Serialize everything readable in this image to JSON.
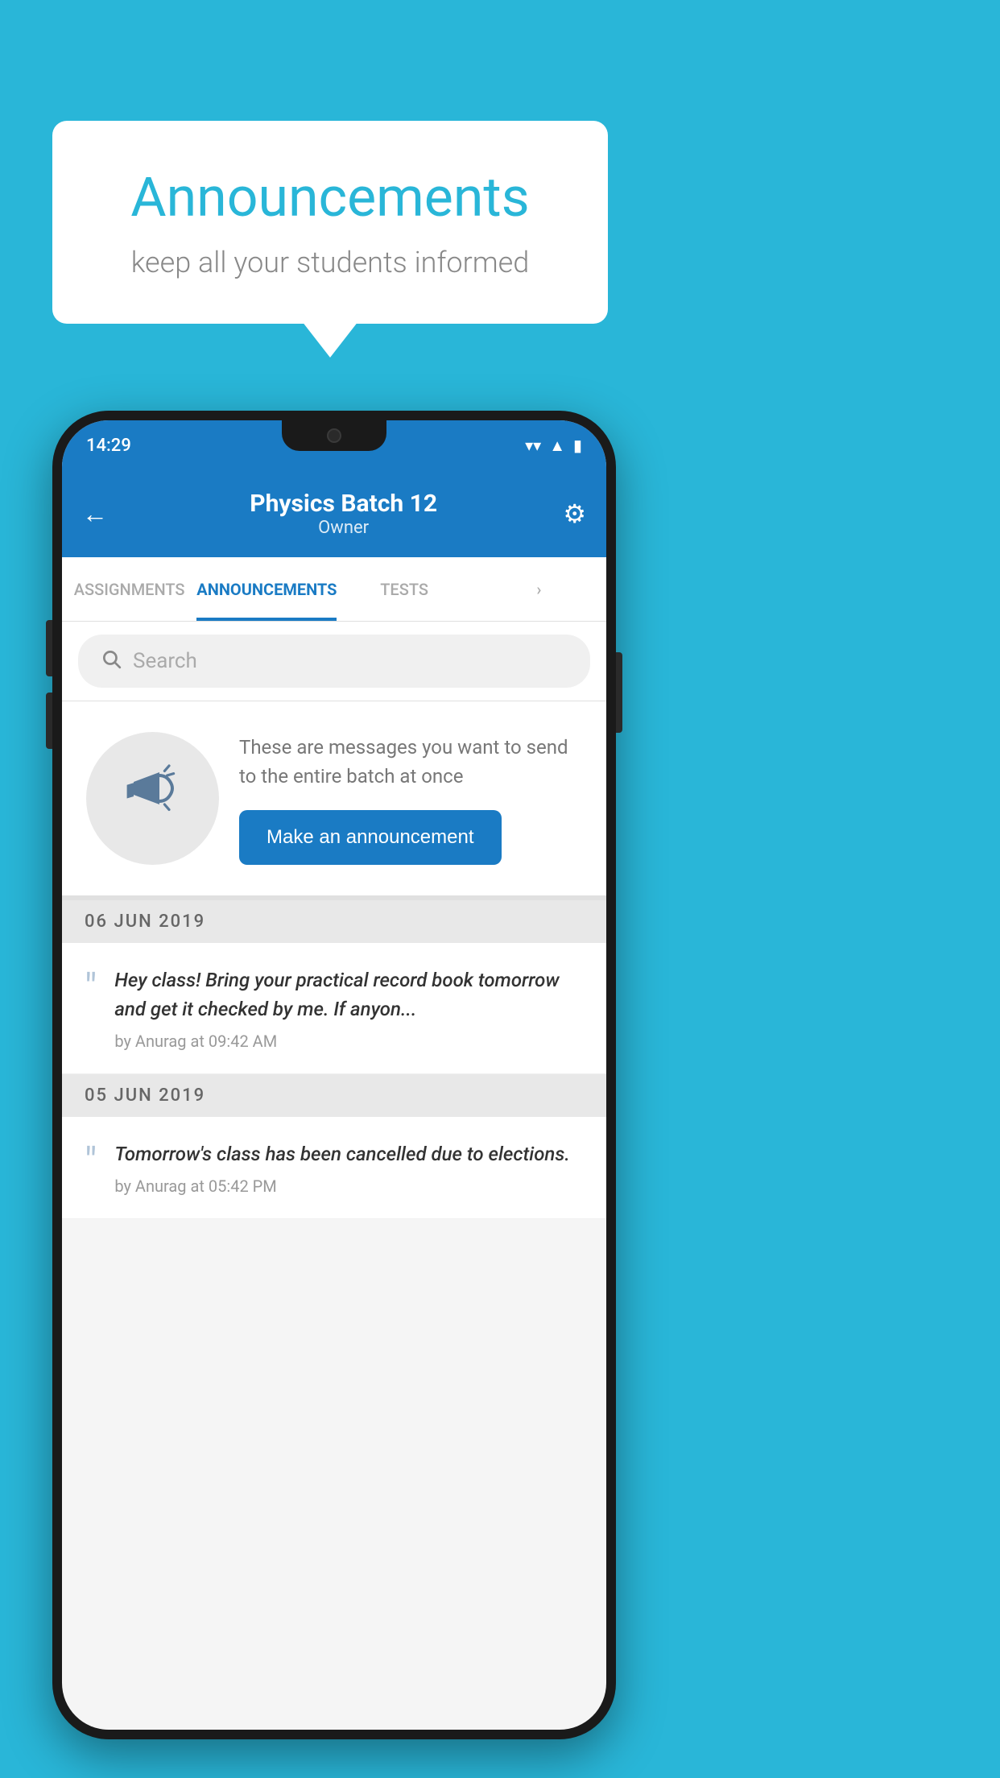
{
  "background_color": "#29b6d8",
  "speech_bubble": {
    "title": "Announcements",
    "subtitle": "keep all your students informed"
  },
  "phone": {
    "status_bar": {
      "time": "14:29",
      "icons": [
        "wifi",
        "signal",
        "battery"
      ]
    },
    "app_bar": {
      "title": "Physics Batch 12",
      "subtitle": "Owner",
      "back_label": "←",
      "settings_label": "⚙"
    },
    "tabs": [
      {
        "label": "ASSIGNMENTS",
        "active": false
      },
      {
        "label": "ANNOUNCEMENTS",
        "active": true
      },
      {
        "label": "TESTS",
        "active": false
      },
      {
        "label": "...",
        "active": false
      }
    ],
    "search": {
      "placeholder": "Search"
    },
    "promo": {
      "text": "These are messages you want to send to the entire batch at once",
      "button_label": "Make an announcement"
    },
    "announcements": [
      {
        "date": "06  JUN  2019",
        "items": [
          {
            "message": "Hey class! Bring your practical record book tomorrow and get it checked by me. If anyon...",
            "meta": "by Anurag at 09:42 AM"
          }
        ]
      },
      {
        "date": "05  JUN  2019",
        "items": [
          {
            "message": "Tomorrow's class has been cancelled due to elections.",
            "meta": "by Anurag at 05:42 PM"
          }
        ]
      }
    ]
  }
}
